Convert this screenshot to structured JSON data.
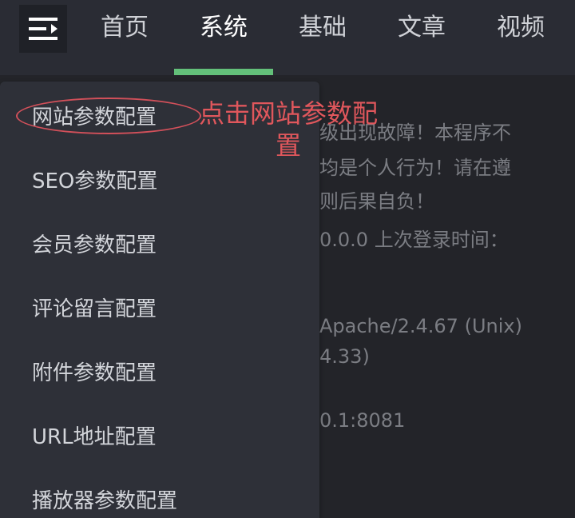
{
  "nav": {
    "tabs": [
      {
        "label": "首页"
      },
      {
        "label": "系统"
      },
      {
        "label": "基础"
      },
      {
        "label": "文章"
      },
      {
        "label": "视频"
      }
    ],
    "active_index": 1,
    "accent_color": "#63c07a"
  },
  "menu_button": {
    "icon": "menu-collapse-icon"
  },
  "dropdown": {
    "items": [
      {
        "label": "网站参数配置"
      },
      {
        "label": "SEO参数配置"
      },
      {
        "label": "会员参数配置"
      },
      {
        "label": "评论留言配置"
      },
      {
        "label": "附件参数配置"
      },
      {
        "label": "URL地址配置"
      },
      {
        "label": "播放器参数配置"
      }
    ]
  },
  "annotation": {
    "text": "点击网站参数配置",
    "color": "#e0575c"
  },
  "background_text": {
    "lines": [
      "级出现故障！本程序不",
      "均是个人行为！请在遵",
      "则后果自负！",
      "0.0.0 上次登录时间：",
      "Apache/2.4.67 (Unix)",
      "4.33)",
      "0.1:8081"
    ]
  }
}
